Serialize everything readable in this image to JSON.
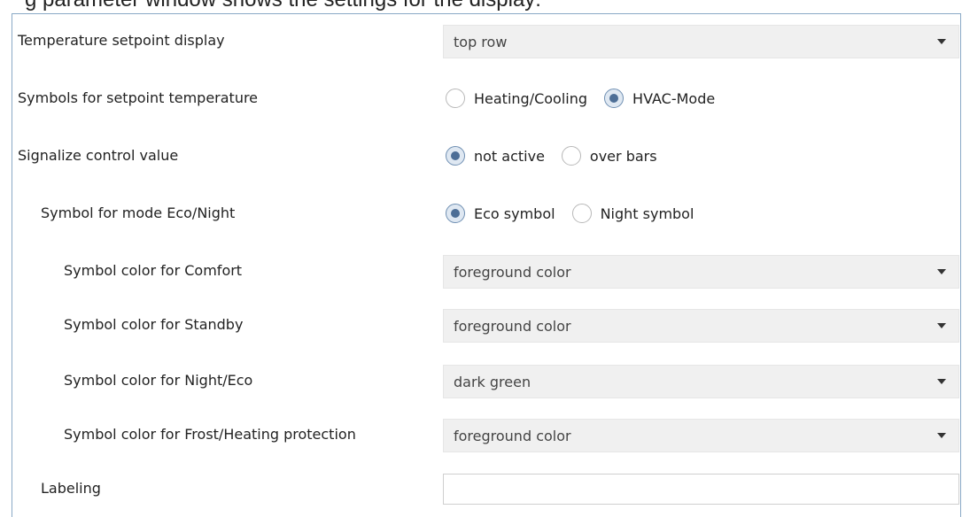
{
  "caption_fragment": "g parameter window shows the settings for the display:",
  "rows": [
    {
      "label": "Temperature setpoint display",
      "type": "select",
      "value": "top row"
    },
    {
      "label": "Symbols for setpoint temperature",
      "type": "radio",
      "options": [
        "Heating/Cooling",
        "HVAC-Mode"
      ],
      "selected": 1
    },
    {
      "label": "Signalize control value",
      "type": "radio",
      "options": [
        "not active",
        "over bars"
      ],
      "selected": 0
    },
    {
      "label": "Symbol for mode Eco/Night",
      "type": "radio",
      "options": [
        "Eco symbol",
        "Night symbol"
      ],
      "selected": 0
    },
    {
      "label": "Symbol color for Comfort",
      "type": "select",
      "value": "foreground color"
    },
    {
      "label": "Symbol color for Standby",
      "type": "select",
      "value": "foreground color"
    },
    {
      "label": "Symbol color for Night/Eco",
      "type": "select",
      "value": "dark green"
    },
    {
      "label": "Symbol color for Frost/Heating protection",
      "type": "select",
      "value": "foreground color"
    },
    {
      "label": "Labeling",
      "type": "text",
      "value": ""
    }
  ],
  "icons": {
    "dropdown": "chevron-down-icon"
  },
  "colors": {
    "panel_border": "#8aa9c6",
    "select_bg": "#f0f0f0",
    "radio_checked_dot": "#4d6e96",
    "radio_checked_fill": "#dfe8f2"
  }
}
